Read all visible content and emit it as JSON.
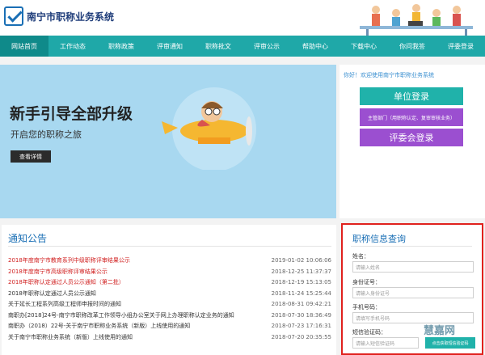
{
  "header": {
    "site_title": "南宁市职称业务系统"
  },
  "nav": {
    "items": [
      "网站首页",
      "工作动态",
      "职称政策",
      "评审通知",
      "职称批文",
      "评审公示",
      "帮助中心",
      "下载中心",
      "你问我答",
      "评委登录"
    ]
  },
  "banner": {
    "title": "新手引导全部升级",
    "subtitle": "开启您的职称之旅",
    "button": "查看详情"
  },
  "login": {
    "welcome": "你好！欢迎使用南宁市职称业务系统",
    "unit_login": "单位登录",
    "dept_login": "主管部门（用职称认定、复审审核业务）",
    "review_login": "评委会登录"
  },
  "notices": {
    "title": "通知公告",
    "items": [
      {
        "text": "2018年度南宁市教育系列中级职称评审结果公示",
        "date": "2019-01-02 10:06:06",
        "highlight": true
      },
      {
        "text": "2018年度南宁市高级职称评审结果公示",
        "date": "2018-12-25 11:37:37",
        "highlight": true
      },
      {
        "text": "2018年职称认定通过人员公示通知（第二批）",
        "date": "2018-12-19 15:13:05",
        "highlight": true
      },
      {
        "text": "2018年职称认定通过人员公示通知",
        "date": "2018-11-24 15:25:44",
        "highlight": false
      },
      {
        "text": "关于延长工程系列高级工程师申报时间的通知",
        "date": "2018-08-31 09:42:21",
        "highlight": false
      },
      {
        "text": "南职办[2018]24号-南宁市职称改革工作领导小组办公室关于网上办理职称认定业务的通知",
        "date": "2018-07-30 18:36:49",
        "highlight": false
      },
      {
        "text": "南职办（2018）22号-关于南宁市职称业务系统（新版）上线使用的通知",
        "date": "2018-07-23 17:16:31",
        "highlight": false
      },
      {
        "text": "关于南宁市职称业务系统（新版）上线使用的通知",
        "date": "2018-07-20 20:35:55",
        "highlight": false
      }
    ]
  },
  "query": {
    "title": "职称信息查询",
    "name_label": "姓名：",
    "name_placeholder": "请输入姓名",
    "id_label": "身份证号：",
    "id_placeholder": "请输入身份证号",
    "phone_label": "手机号码：",
    "phone_placeholder": "请填写手机号码",
    "sms_label": "短信验证码：",
    "sms_placeholder": "请输入短信验证码",
    "sms_button": "点击获取短信验证码",
    "watermark": "慧嘉网"
  }
}
